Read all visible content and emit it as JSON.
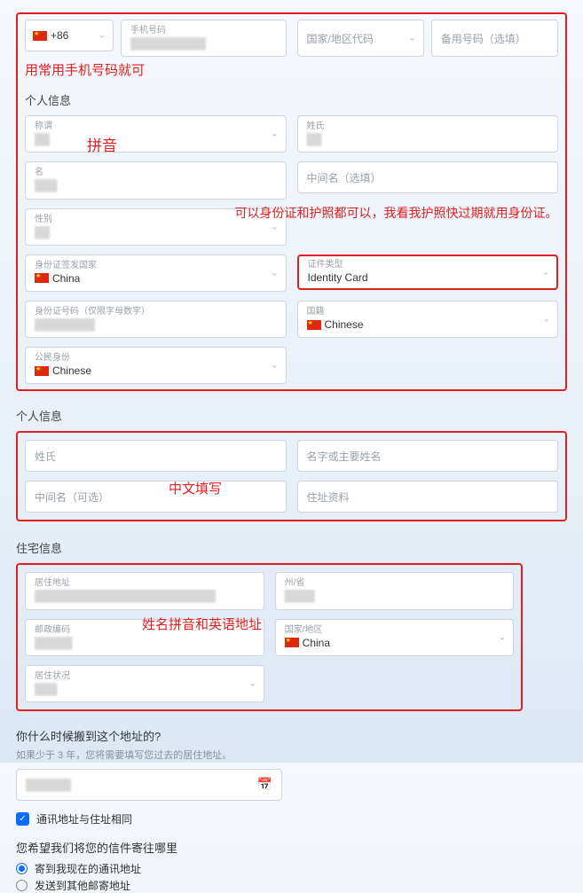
{
  "phone": {
    "prefix": "+86",
    "label": "手机号码",
    "region_code": "国家/地区代码",
    "backup": "备用号码（选填）",
    "annotation": "用常用手机号码就可"
  },
  "section1": {
    "title": "个人信息",
    "annot_pinyin": "拼音",
    "fields": {
      "title": "称谓",
      "surname": "姓氏",
      "name": "名",
      "middle": "中间名（选填）",
      "gender": "性别",
      "idcountry_lbl": "身份证签发国家",
      "idcountry_val": "China",
      "idtype_lbl": "证件类型",
      "idtype_val": "Identity Card",
      "idnum": "身份证号码（仅限字母数字）",
      "nat_lbl": "国籍",
      "nat_val": "Chinese",
      "ctz_lbl": "公民身份",
      "ctz_val": "Chinese"
    },
    "idtype_annotation": "可以身份证和护照都可以，我看我护照快过期就用身份证。"
  },
  "section2": {
    "title": "个人信息",
    "annot": "中文填写",
    "fields": {
      "surname": "姓氏",
      "given": "名字或主要姓名",
      "middle": "中间名（可选）",
      "addr": "住址资料"
    }
  },
  "section3": {
    "title": "住宅信息",
    "annot": "姓名拼音和英语地址",
    "fields": {
      "res_addr": "居住地址",
      "state": "州/省",
      "zip": "邮政编码",
      "country_lbl": "国家/地区",
      "country_val": "China",
      "res_status": "居住状况"
    }
  },
  "move": {
    "q": "你什么时候搬到这个地址的?",
    "sub": "如果少于 3 年，您将需要填写您过去的居住地址。"
  },
  "mail_same": "通讯地址与住址相同",
  "mail_pref": {
    "q": "您希望我们将您的信件寄往哪里",
    "opt1": "寄到我现在的通讯地址",
    "opt2": "发送到其他邮寄地址"
  }
}
